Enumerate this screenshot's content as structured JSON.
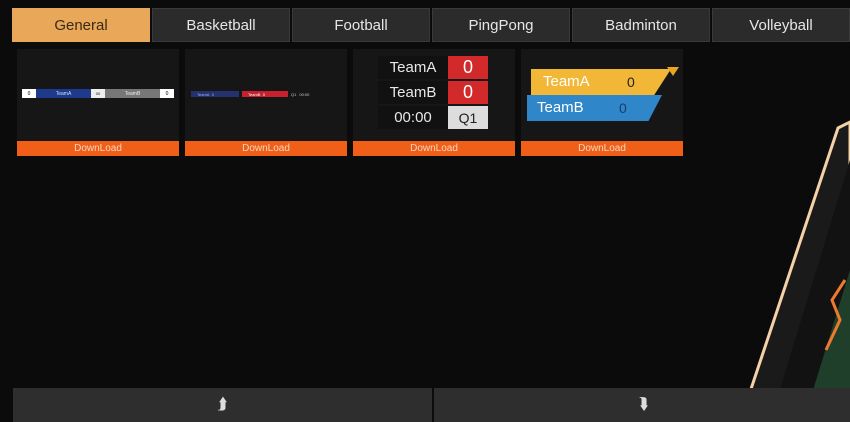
{
  "tabs": [
    "General",
    "Basketball",
    "Football",
    "PingPong",
    "Badminton",
    "Volleyball"
  ],
  "active_tab": 0,
  "cards": {
    "download_label": "DownLoad"
  },
  "thumb1": {
    "left_score": "0",
    "left_team": "TeamA",
    "right_team": "TeamB",
    "right_score": "0",
    "mid_top": "00",
    "mid_bot": "Q1"
  },
  "thumb2": {
    "team_a": "TeamA",
    "score_a": "0",
    "team_b": "TeamB",
    "score_b": "0",
    "period": "Q1",
    "clock": "00:00"
  },
  "thumb3": {
    "team_a": "TeamA",
    "score_a": "0",
    "team_b": "TeamB",
    "score_b": "0",
    "clock": "00:00",
    "period": "Q1"
  },
  "thumb4": {
    "team_a": "TeamA",
    "score_a": "0",
    "team_b": "TeamB",
    "score_b": "0"
  },
  "colors": {
    "active_tab": "#e9a759",
    "download": "#ef5f17",
    "score_red": "#d22a2a",
    "team_blue": "#2f86c8",
    "team_yellow": "#f2b736"
  },
  "nav": {
    "up_icon": "chevron-double-up",
    "down_icon": "chevron-double-down"
  }
}
